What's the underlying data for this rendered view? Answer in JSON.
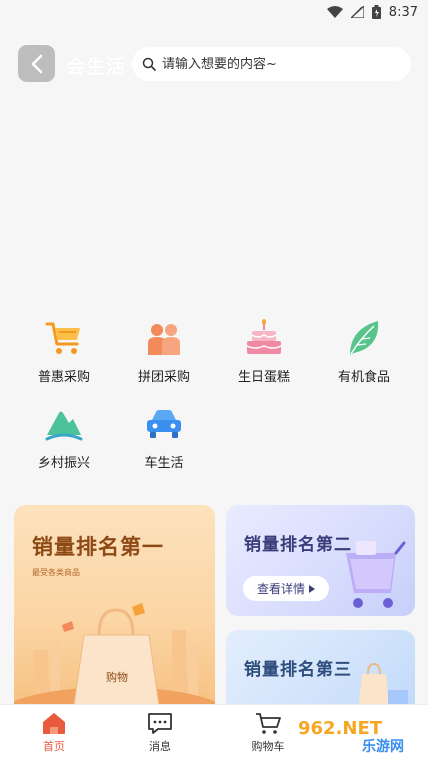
{
  "status_bar": {
    "time": "8:37"
  },
  "header": {
    "title": "会生活",
    "search_placeholder": "请输入想要的内容~"
  },
  "categories": [
    {
      "label": "普惠采购",
      "icon": "shopping-cart-icon"
    },
    {
      "label": "拼团采购",
      "icon": "group-people-icon"
    },
    {
      "label": "生日蛋糕",
      "icon": "cake-icon"
    },
    {
      "label": "有机食品",
      "icon": "leaf-icon"
    },
    {
      "label": "乡村振兴",
      "icon": "mountain-icon"
    },
    {
      "label": "车生活",
      "icon": "car-icon"
    }
  ],
  "promos": {
    "first": {
      "title": "销量排名第一",
      "subtitle": "最受各类商品",
      "bag_text": "购物"
    },
    "second": {
      "title": "销量排名第二",
      "button": "查看详情"
    },
    "third": {
      "title": "销量排名第三"
    }
  },
  "bottom_nav": [
    {
      "label": "首页",
      "icon": "home-icon",
      "active": true
    },
    {
      "label": "消息",
      "icon": "message-icon",
      "active": false
    },
    {
      "label": "购物车",
      "icon": "cart-icon",
      "active": false
    }
  ],
  "watermark": {
    "text": "962.NET",
    "subtext": "乐游网"
  },
  "colors": {
    "accent": "#e85a3c",
    "orange": "#f7a13a",
    "green": "#3fb98a",
    "blue": "#3a8ef0"
  }
}
